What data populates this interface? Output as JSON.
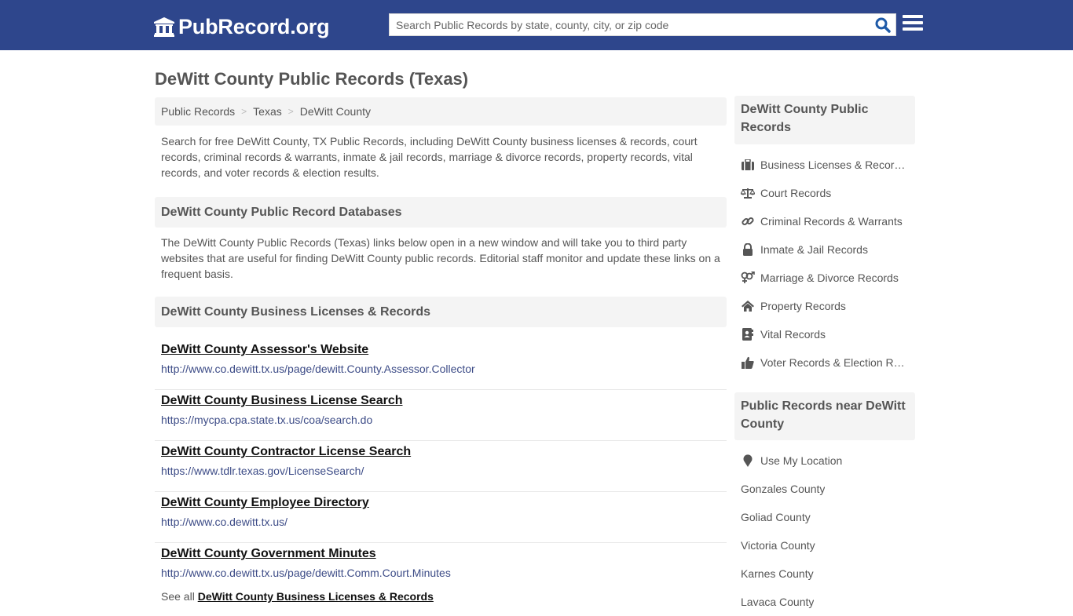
{
  "header": {
    "logo_text": "PubRecord.org",
    "search": {
      "placeholder": "Search Public Records by state, county, city, or zip code",
      "value": ""
    },
    "brand_color": "#2e468c"
  },
  "page": {
    "title": "DeWitt County Public Records (Texas)",
    "breadcrumb": [
      "Public Records",
      "Texas",
      "DeWitt County"
    ],
    "intro": "Search for free DeWitt County, TX Public Records, including DeWitt County business licenses & records, court records, criminal records & warrants, inmate & jail records, marriage & divorce records, property records, vital records, and voter records & election results.",
    "databases_heading": "DeWitt County Public Record Databases",
    "databases_desc": "The DeWitt County Public Records (Texas) links below open in a new window and will take you to third party websites that are useful for finding DeWitt County public records. Editorial staff monitor and update these links on a frequent basis.",
    "business_heading": "DeWitt County Business Licenses & Records",
    "records": [
      {
        "title": "DeWitt County Assessor's Website",
        "url": "http://www.co.dewitt.tx.us/page/dewitt.County.Assessor.Collector"
      },
      {
        "title": "DeWitt County Business License Search",
        "url": "https://mycpa.cpa.state.tx.us/coa/search.do"
      },
      {
        "title": "DeWitt County Contractor License Search",
        "url": "https://www.tdlr.texas.gov/LicenseSearch/"
      },
      {
        "title": "DeWitt County Employee Directory",
        "url": "http://www.co.dewitt.tx.us/"
      },
      {
        "title": "DeWitt County Government Minutes",
        "url": "http://www.co.dewitt.tx.us/page/dewitt.Comm.Court.Minutes"
      }
    ],
    "see_all_prefix": "See all",
    "see_all_link": "DeWitt County Business Licenses & Records"
  },
  "sidebar": {
    "records_heading": "DeWitt County Public Records",
    "record_links": [
      {
        "icon": "briefcase-icon",
        "label": "Business Licenses & Records"
      },
      {
        "icon": "balance-scale-icon",
        "label": "Court Records"
      },
      {
        "icon": "link-icon",
        "label": "Criminal Records & Warrants"
      },
      {
        "icon": "lock-icon",
        "label": "Inmate & Jail Records"
      },
      {
        "icon": "venus-mars-icon",
        "label": "Marriage & Divorce Records"
      },
      {
        "icon": "home-icon",
        "label": "Property Records"
      },
      {
        "icon": "address-book-icon",
        "label": "Vital Records"
      },
      {
        "icon": "thumbs-up-icon",
        "label": "Voter Records & Election Results"
      }
    ],
    "nearby_heading": "Public Records near DeWitt County",
    "use_location": "Use My Location",
    "nearby": [
      "Gonzales County",
      "Goliad County",
      "Victoria County",
      "Karnes County",
      "Lavaca County"
    ]
  }
}
